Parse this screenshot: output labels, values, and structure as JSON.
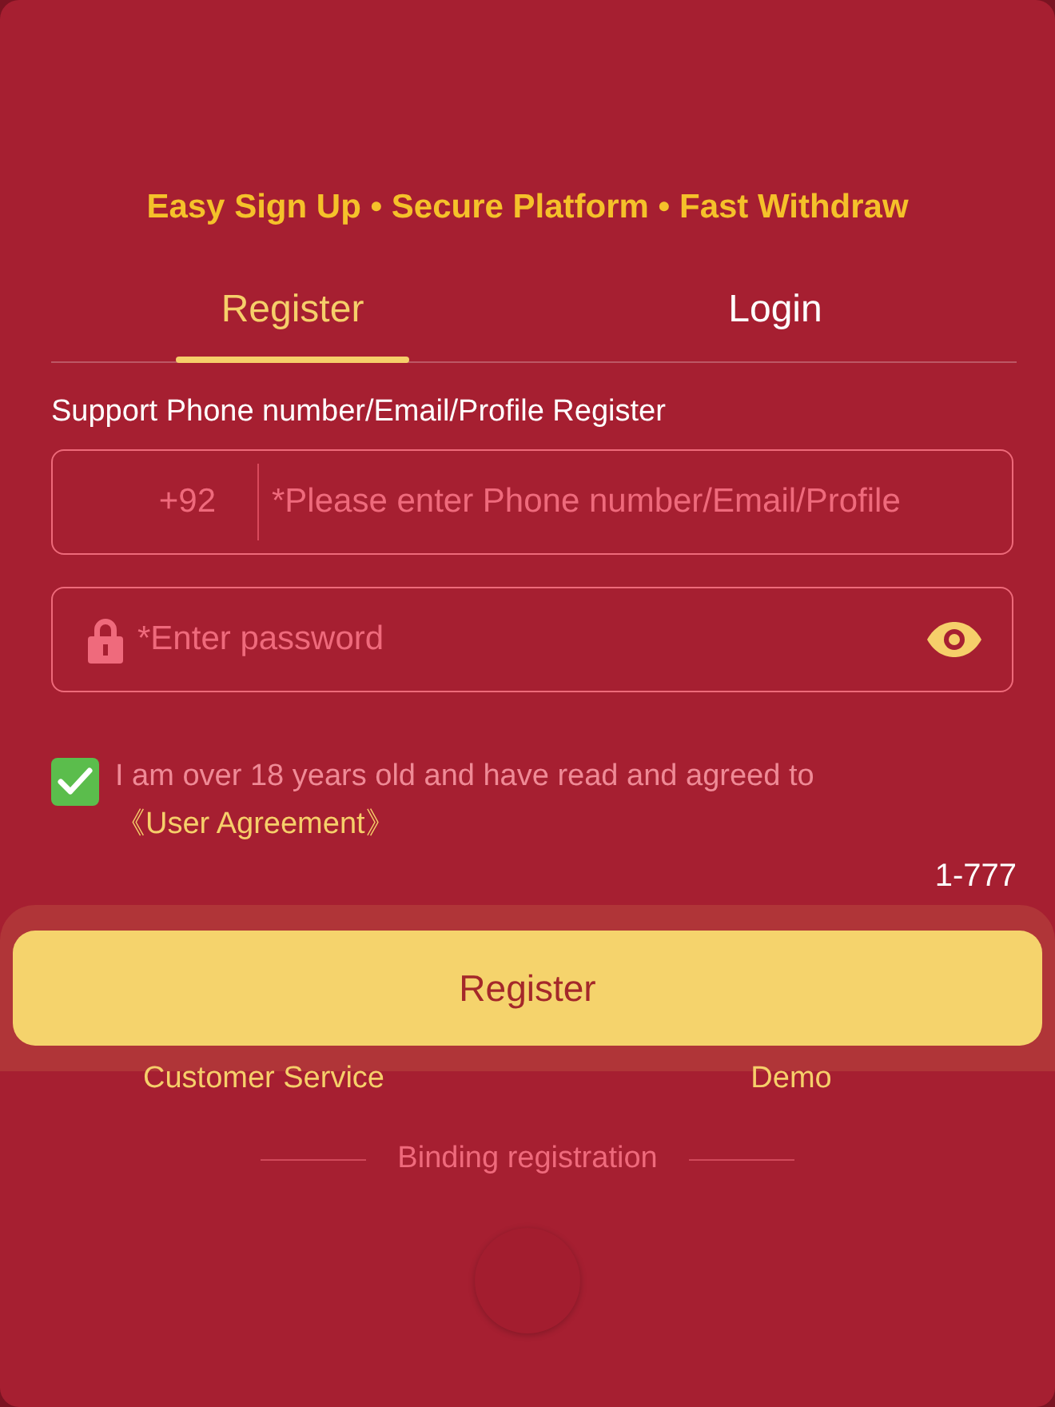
{
  "tagline": "Easy Sign Up • Secure Platform • Fast Withdraw",
  "tabs": [
    {
      "label": "Register",
      "selected": true
    },
    {
      "label": "Login",
      "selected": false
    }
  ],
  "hint": "Support Phone number/Email/Profile Register",
  "phone_field": {
    "prefix": "+92",
    "placeholder": "*Please enter Phone number/Email/Profile"
  },
  "password_field": {
    "placeholder": "*Enter password"
  },
  "agreement": {
    "checked": true,
    "text": "I am over 18 years old and have read and agreed to",
    "link": "《User Agreement》"
  },
  "code": "1-777",
  "register_button": "Register",
  "links": [
    "Customer Service",
    "Demo"
  ],
  "divider_label": "Binding registration"
}
